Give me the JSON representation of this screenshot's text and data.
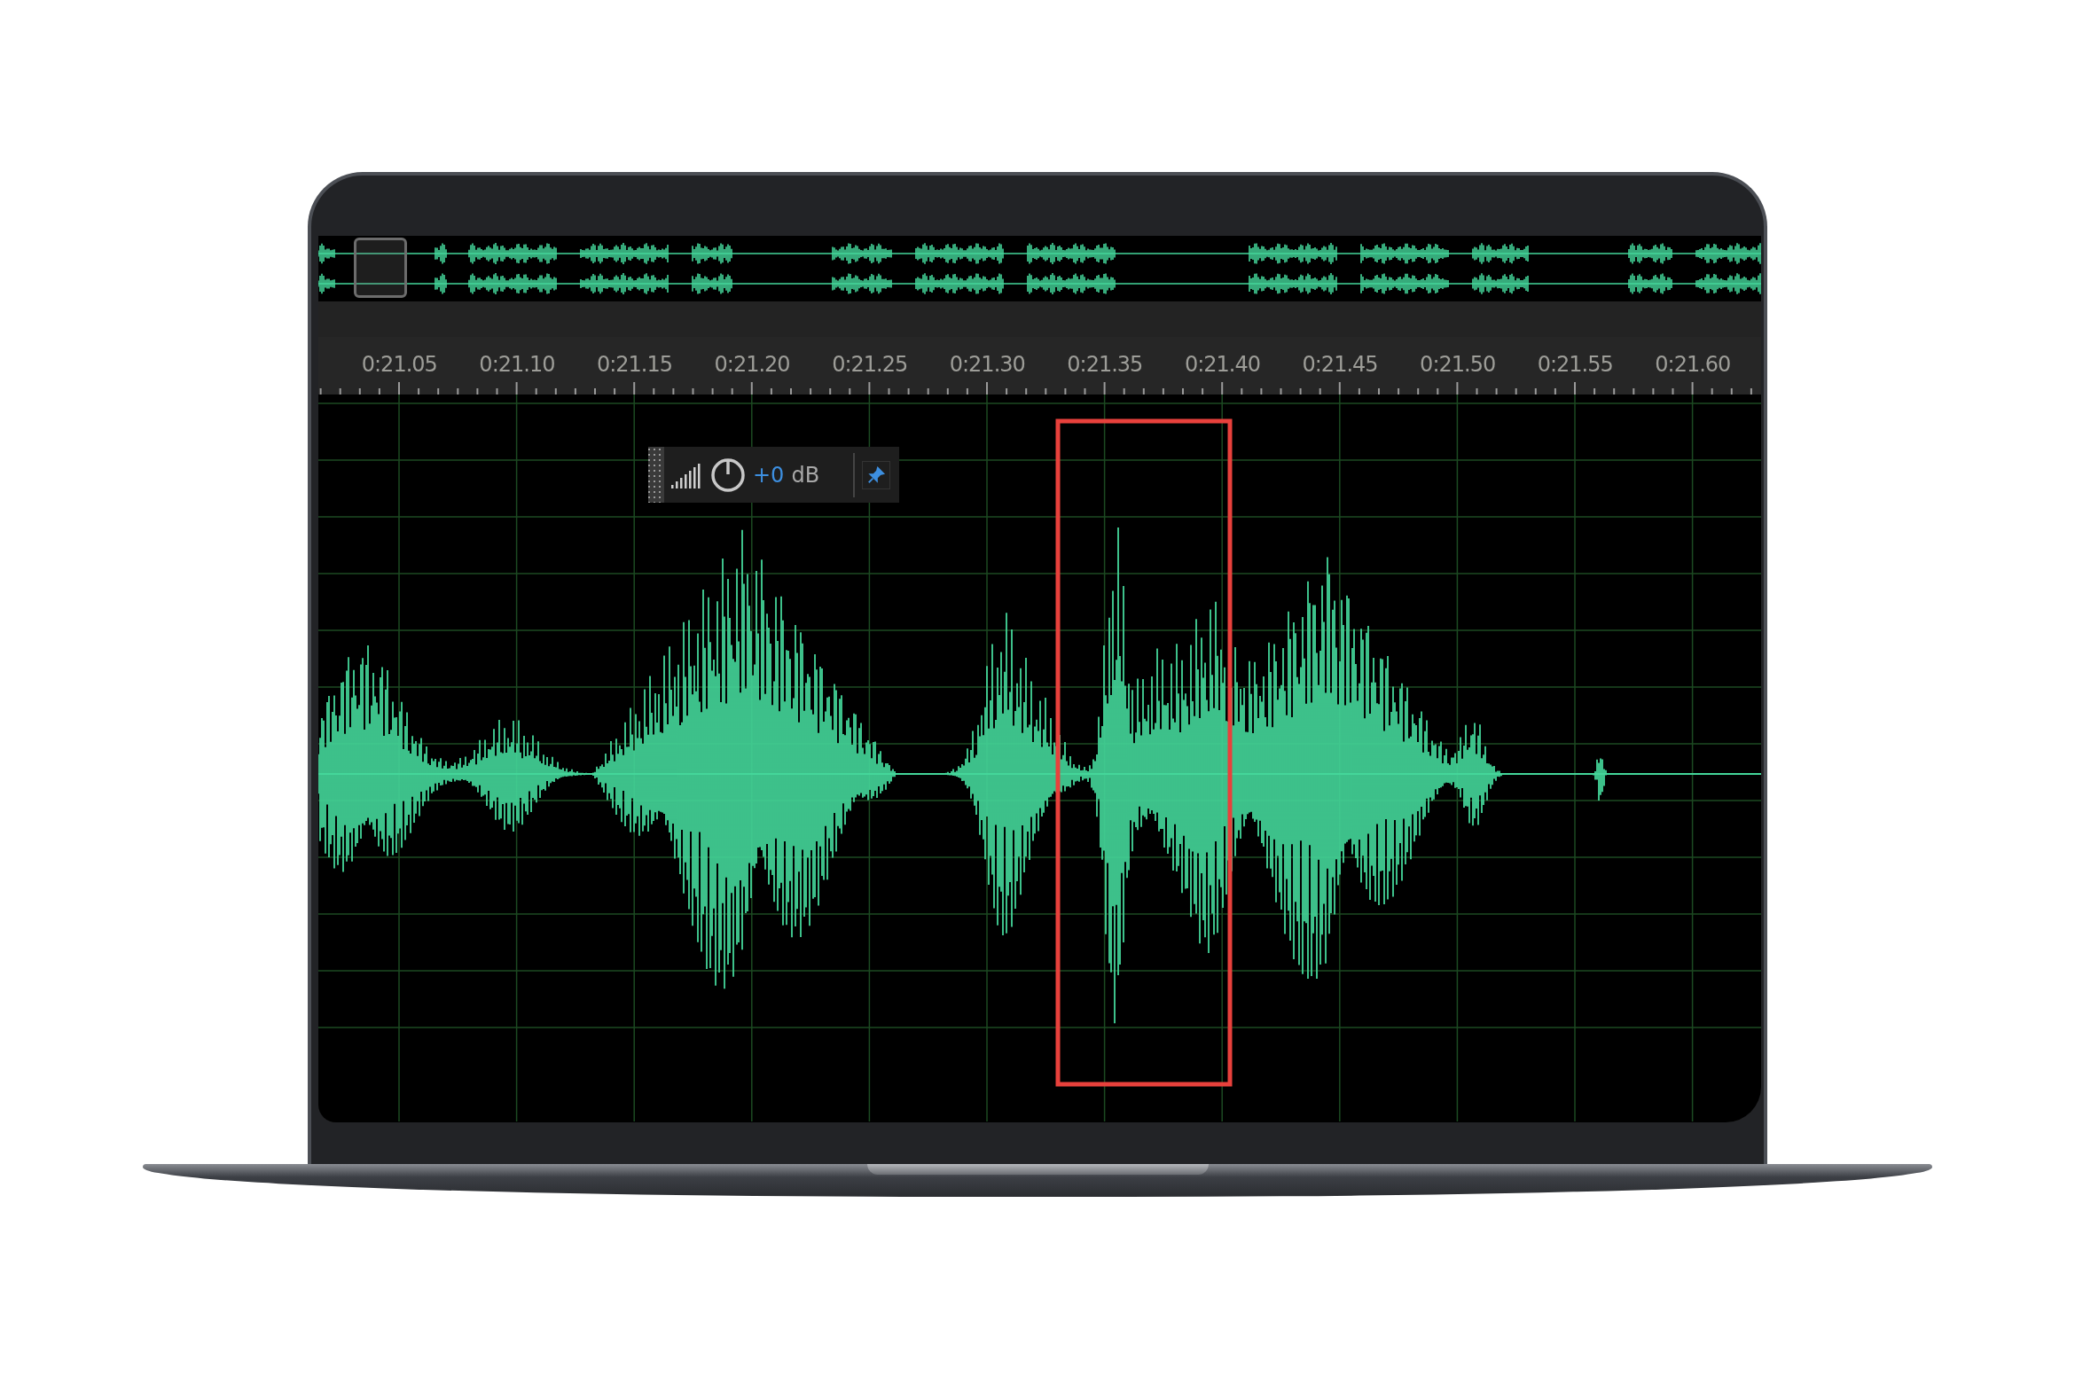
{
  "ruler": {
    "labels": [
      "0:21.05",
      "0:21.10",
      "0:21.15",
      "0:21.20",
      "0:21.25",
      "0:21.30",
      "0:21.35",
      "0:21.40",
      "0:21.45",
      "0:21.50",
      "0:21.55",
      "0:21.60"
    ]
  },
  "gain_toolbar": {
    "value": "+0",
    "unit": "dB"
  }
}
